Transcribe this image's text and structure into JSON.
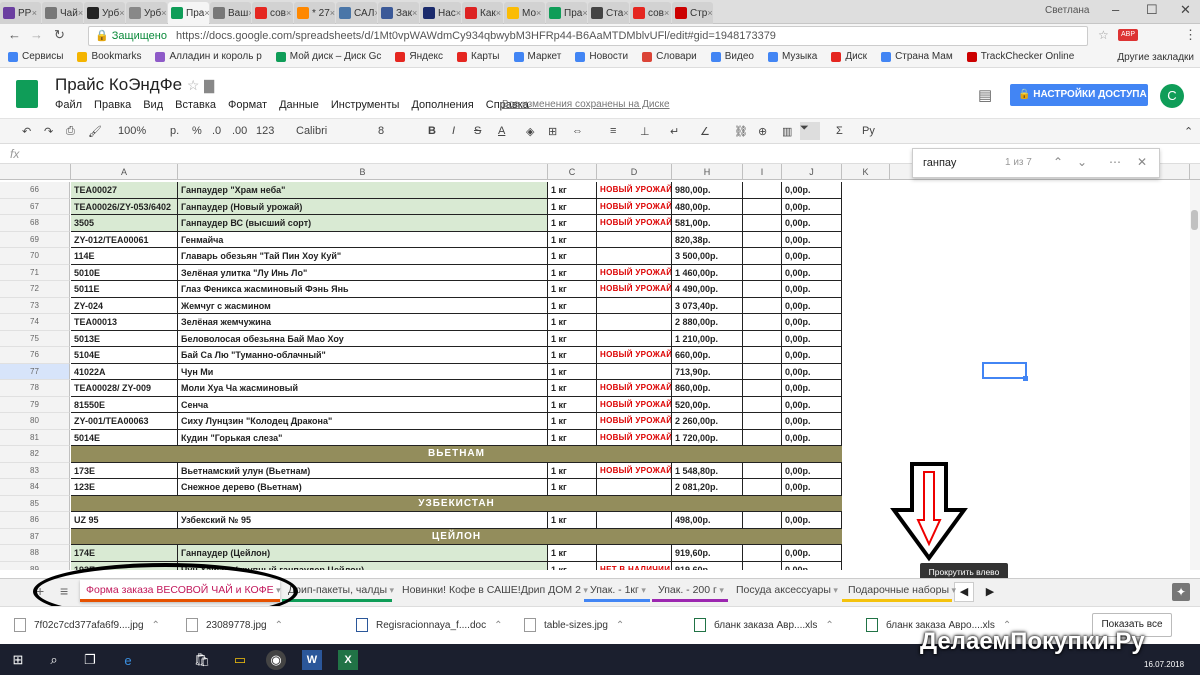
{
  "browser": {
    "tabs": [
      {
        "label": "PP",
        "color": "#6b3fa0",
        "active": false
      },
      {
        "label": "Чай",
        "color": "#777",
        "active": false
      },
      {
        "label": "Урб",
        "color": "#222",
        "active": false
      },
      {
        "label": "Урб",
        "color": "#888",
        "active": false
      },
      {
        "label": "Пра",
        "color": "#0f9d58",
        "active": true
      },
      {
        "label": "Ваш",
        "color": "#777",
        "active": false
      },
      {
        "label": "сов",
        "color": "#e52620",
        "active": false
      },
      {
        "label": "* 27",
        "color": "#ff8800",
        "active": false
      },
      {
        "label": "САЛ",
        "color": "#4a76a8",
        "active": false
      },
      {
        "label": "Зак",
        "color": "#3b5998",
        "active": false
      },
      {
        "label": "Нас",
        "color": "#1a2a6c",
        "active": false
      },
      {
        "label": "Как",
        "color": "#d22",
        "active": false
      },
      {
        "label": "Мо",
        "color": "#fbbc05",
        "active": false
      },
      {
        "label": "Пра",
        "color": "#0f9d58",
        "active": false
      },
      {
        "label": "Ста",
        "color": "#444",
        "active": false
      },
      {
        "label": "сов",
        "color": "#e52620",
        "active": false
      },
      {
        "label": "Стр",
        "color": "#c00",
        "active": false
      }
    ],
    "user": "Светлана",
    "secure_label": "Защищено",
    "url": "https://docs.google.com/spreadsheets/d/1Mt0vpWAWdmCy934qbwybM3HFRp44-B6AaMTDMblvUFl/edit#gid=1948173379",
    "bookmarks": [
      "Сервисы",
      "Bookmarks",
      "Алладин и король р",
      "Мой диск – Диск Gc",
      "Яндекс",
      "Карты",
      "Маркет",
      "Новости",
      "Словари",
      "Видео",
      "Музыка",
      "Диск",
      "Страна Мам",
      "TrackChecker Online"
    ],
    "other_bookmarks": "Другие закладки"
  },
  "docs": {
    "title": "Прайс КоЭндФе",
    "menu": [
      "Файл",
      "Правка",
      "Вид",
      "Вставка",
      "Формат",
      "Данные",
      "Инструменты",
      "Дополнения",
      "Справка"
    ],
    "saved_status": "Все изменения сохранены на Диске",
    "share_label": "НАСТРОЙКИ ДОСТУПА",
    "avatar_letter": "С"
  },
  "toolbar": {
    "zoom": "100%",
    "currency": "р.",
    "percent": "%",
    "dec_less": ".0",
    "dec_more": ".00",
    "number_format": "123",
    "font": "Calibri",
    "font_size": "8",
    "bold": "B",
    "italic": "I",
    "strike": "S",
    "text_color": "A",
    "functions": "Σ",
    "input_lang": "Ру"
  },
  "formula": {
    "fx": "fx"
  },
  "find": {
    "query": "ганпау",
    "count": "1 из 7"
  },
  "columns": [
    "A",
    "B",
    "C",
    "D",
    "H",
    "I",
    "J",
    "K",
    "L"
  ],
  "rows": [
    {
      "n": "66",
      "a": "TEA00027",
      "b": "Ганпаудер \"Храм неба\"",
      "c": "1 кг",
      "d": "НОВЫЙ УРОЖАЙ",
      "h": "980,00р.",
      "j": "0,00р.",
      "hl": true
    },
    {
      "n": "67",
      "a": "TEA00026/ZY-053/6402",
      "b": "Ганпаудер  (Новый урожай)",
      "c": "1 кг",
      "d": "НОВЫЙ УРОЖАЙ",
      "h": "480,00р.",
      "j": "0,00р.",
      "hl": true
    },
    {
      "n": "68",
      "a": "3505",
      "b": "Ганпаудер ВС (высший сорт)",
      "c": "1 кг",
      "d": "НОВЫЙ УРОЖАЙ",
      "h": "581,00р.",
      "j": "0,00р.",
      "hl": true
    },
    {
      "n": "69",
      "a": "ZY-012/TEA00061",
      "b": "Генмайча",
      "c": "1 кг",
      "d": "",
      "h": "820,38р.",
      "j": "0,00р."
    },
    {
      "n": "70",
      "a": "114E",
      "b": "Главарь обезьян \"Тай Пин Хоу Куй\"",
      "c": "1 кг",
      "d": "",
      "h": "3 500,00р.",
      "j": "0,00р."
    },
    {
      "n": "71",
      "a": "5010E",
      "b": "Зелёная улитка \"Лу Инь Ло\"",
      "c": "1 кг",
      "d": "НОВЫЙ УРОЖАЙ",
      "h": "1 460,00р.",
      "j": "0,00р."
    },
    {
      "n": "72",
      "a": "5011E",
      "b": "Глаз Феникса жасминовый Фэнь Янь",
      "c": "1 кг",
      "d": "НОВЫЙ УРОЖАЙ",
      "h": "4 490,00р.",
      "j": "0,00р."
    },
    {
      "n": "73",
      "a": "ZY-024",
      "b": "Жемчуг с жасмином",
      "c": "1 кг",
      "d": "",
      "h": "3 073,40р.",
      "j": "0,00р."
    },
    {
      "n": "74",
      "a": "TEA00013",
      "b": "Зелёная жемчужина",
      "c": "1 кг",
      "d": "",
      "h": "2 880,00р.",
      "j": "0,00р."
    },
    {
      "n": "75",
      "a": "5013E",
      "b": "Беловолосая обезьяна Бай Мао Хоу",
      "c": "1 кг",
      "d": "",
      "h": "1 210,00р.",
      "j": "0,00р."
    },
    {
      "n": "76",
      "a": "5104E",
      "b": "Бай Са Лю \"Туманно-облачный\"",
      "c": "1 кг",
      "d": "НОВЫЙ УРОЖАЙ",
      "h": "660,00р.",
      "j": "0,00р."
    },
    {
      "n": "77",
      "a": "41022A",
      "b": "Чун Ми",
      "c": "1 кг",
      "d": "",
      "h": "713,90р.",
      "j": "0,00р.",
      "sel": true
    },
    {
      "n": "78",
      "a": "TEA00028/ ZY-009",
      "b": "Моли Хуа Ча жасминовый",
      "c": "1 кг",
      "d": "НОВЫЙ УРОЖАЙ",
      "h": "860,00р.",
      "j": "0,00р."
    },
    {
      "n": "79",
      "a": "81550E",
      "b": "Сенча",
      "c": "1 кг",
      "d": "НОВЫЙ УРОЖАЙ",
      "h": "520,00р.",
      "j": "0,00р."
    },
    {
      "n": "80",
      "a": "ZY-001/TEA00063",
      "b": "Сиху Лунцзин  \"Колодец Дракона\"",
      "c": "1 кг",
      "d": "НОВЫЙ УРОЖАЙ",
      "h": "2 260,00р.",
      "j": "0,00р."
    },
    {
      "n": "81",
      "a": "5014E",
      "b": "Кудин \"Горькая слеза\"",
      "c": "1 кг",
      "d": "НОВЫЙ УРОЖАЙ",
      "h": "1 720,00р.",
      "j": "0,00р."
    },
    {
      "n": "82",
      "section": "ВЬЕТНАМ"
    },
    {
      "n": "83",
      "a": "173E",
      "b": "Вьетнамский улун (Вьетнам)",
      "c": "1 кг",
      "d": "НОВЫЙ УРОЖАЙ",
      "h": "1 548,80р.",
      "j": "0,00р."
    },
    {
      "n": "84",
      "a": "123E",
      "b": "Снежное дерево (Вьетнам)",
      "c": "1 кг",
      "d": "",
      "h": "2 081,20р.",
      "j": "0,00р."
    },
    {
      "n": "85",
      "section": "УЗБЕКИСТАН"
    },
    {
      "n": "86",
      "a": "UZ 95",
      "b": "Узбекский № 95",
      "c": "1 кг",
      "d": "",
      "h": "498,00р.",
      "j": "0,00р."
    },
    {
      "n": "87",
      "section": "ЦЕЙЛОН"
    },
    {
      "n": "88",
      "a": "174E",
      "b": "Ганпаудер (Цейлон)",
      "c": "1 кг",
      "d": "",
      "h": "919,60р.",
      "j": "0,00р.",
      "hl": true
    },
    {
      "n": "89",
      "a": "193E",
      "b": "Чун Хайсен (крупный ганпаудер Цейлон)",
      "c": "1 кг",
      "d": "НЕТ В НАЛИЧИИ",
      "h": "919,60р.",
      "j": "0,00р.",
      "hl": true
    }
  ],
  "tooltip": "Прокрутить влево",
  "sheet_tabs": [
    {
      "label": "Форма заказа ВЕСОВОЙ ЧАЙ и КОФЕ",
      "color": "#e65100",
      "active": true
    },
    {
      "label": "Дрип-пакеты, чалды",
      "color": "#0f9d58"
    },
    {
      "label": "Новинки! Кофе в САШЕ!Дрип ДОМ 2",
      "color": ""
    },
    {
      "label": "Упак. - 1кг",
      "color": "#4285f4"
    },
    {
      "label": "Упак. - 200 г",
      "color": "#9c27b0"
    },
    {
      "label": "Посуда аксессуары",
      "color": ""
    },
    {
      "label": "Подарочные наборы",
      "color": "#f4c20d"
    }
  ],
  "downloads": [
    "7f02c7cd377afa6f9....jpg",
    "23089778.jpg",
    "Regisracionnaya_f....doc",
    "table-sizes.jpg",
    "бланк заказа Авр....xls",
    "бланк заказа Авро....xls"
  ],
  "show_all": "Показать все",
  "watermark": "ДелаемПокупки.Ру",
  "clock": "16.07.2018"
}
